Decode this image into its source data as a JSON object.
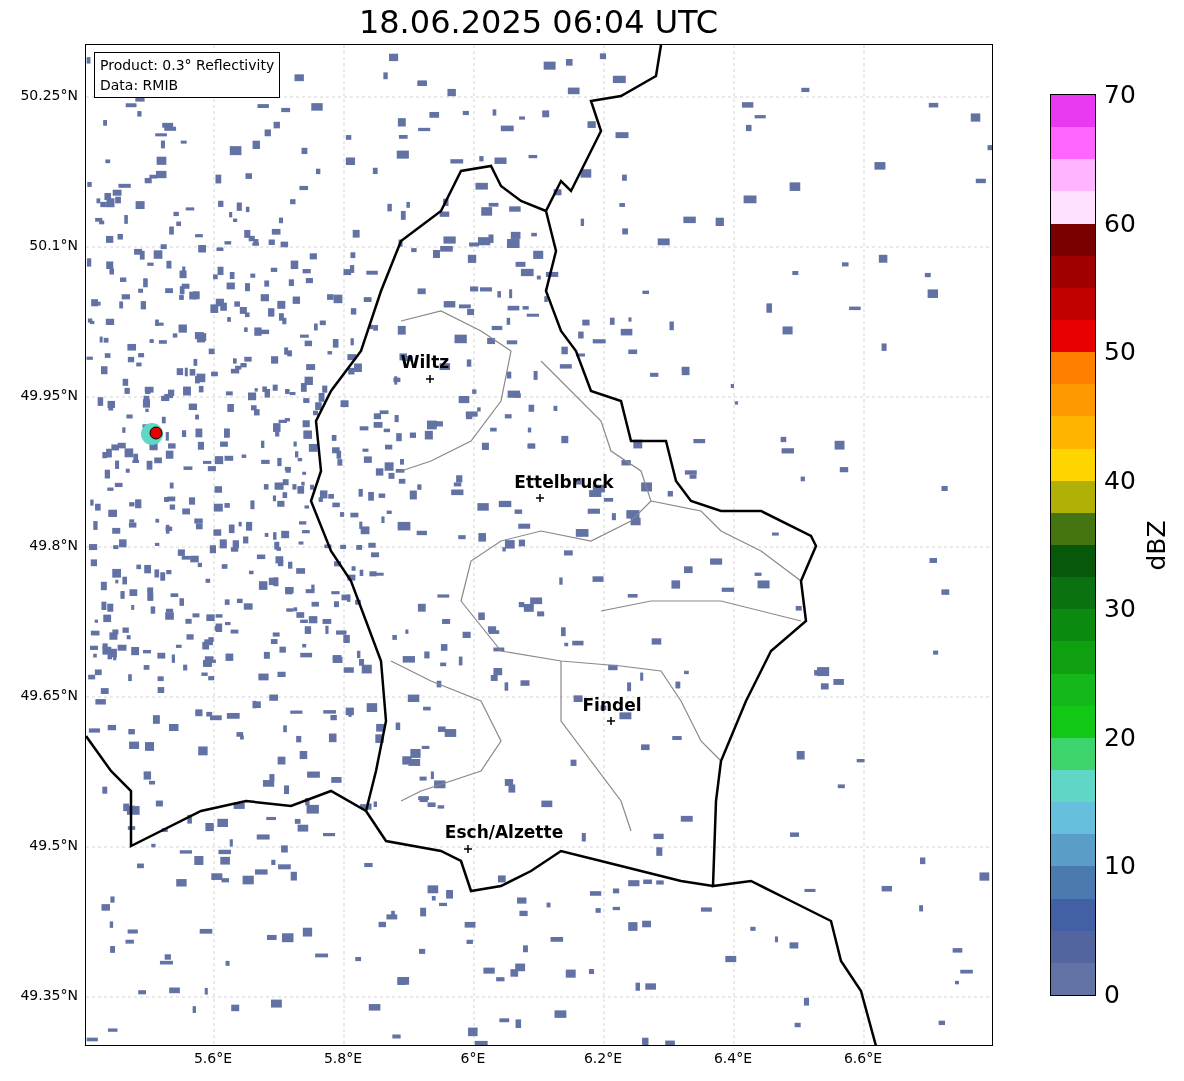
{
  "title": "18.06.2025 06:04 UTC",
  "legend": [
    "Product: 0.3° Reflectivity",
    "Data: RMIB"
  ],
  "map": {
    "cities": [
      {
        "name": "Wiltz"
      },
      {
        "name": "Ettelbruck"
      },
      {
        "name": "Findel"
      },
      {
        "name": "Esch/Alzette"
      }
    ],
    "yticks": [
      "50.25°N",
      "50.1°N",
      "49.95°N",
      "49.8°N",
      "49.65°N",
      "49.5°N",
      "49.35°N"
    ],
    "xticks": [
      "5.6°E",
      "5.8°E",
      "6°E",
      "6.2°E",
      "6.4°E",
      "6.6°E"
    ]
  },
  "colorbar": {
    "label": "dBZ",
    "ticks": [
      "70",
      "60",
      "50",
      "40",
      "30",
      "20",
      "10",
      "0"
    ],
    "bands": [
      {
        "color": "#e838f0"
      },
      {
        "color": "#ff66ff"
      },
      {
        "color": "#ffb4ff"
      },
      {
        "color": "#ffe0ff"
      },
      {
        "color": "#780000"
      },
      {
        "color": "#a00000"
      },
      {
        "color": "#c20000"
      },
      {
        "color": "#e80000"
      },
      {
        "color": "#ff7f00"
      },
      {
        "color": "#ff9900"
      },
      {
        "color": "#ffb400"
      },
      {
        "color": "#ffd500"
      },
      {
        "color": "#b0b006"
      },
      {
        "color": "#457510"
      },
      {
        "color": "#07580b"
      },
      {
        "color": "#0a7210"
      },
      {
        "color": "#0c8a10"
      },
      {
        "color": "#0fa012"
      },
      {
        "color": "#14b81a"
      },
      {
        "color": "#12c817"
      },
      {
        "color": "#3ed46c"
      },
      {
        "color": "#5fd6c6"
      },
      {
        "color": "#66c0dd"
      },
      {
        "color": "#5a9ec8"
      },
      {
        "color": "#4a7ab0"
      },
      {
        "color": "#4460a4"
      },
      {
        "color": "#53659e"
      },
      {
        "color": "#6272a4"
      }
    ]
  }
}
